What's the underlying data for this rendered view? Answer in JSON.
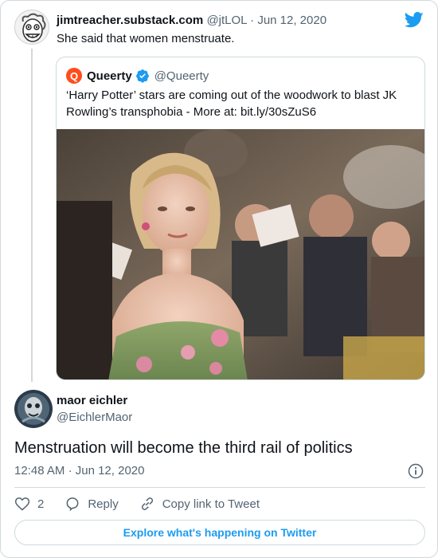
{
  "parent": {
    "display_name": "jimtreacher.substack.com",
    "handle": "@jtLOL",
    "separator": "·",
    "date": "Jun 12, 2020",
    "text": "She said that women menstruate."
  },
  "quoted": {
    "logo_letter": "Q",
    "display_name": "Queerty",
    "handle": "@Queerty",
    "text": "‘Harry Potter’ stars are coming out of the woodwork to blast JK Rowling’s transphobia - More at: bit.ly/30sZuS6"
  },
  "reply": {
    "display_name": "maor eichler",
    "handle": "@EichlerMaor",
    "text": "Menstruation will become the third rail of politics",
    "time": "12:48 AM",
    "separator": "·",
    "date": "Jun 12, 2020"
  },
  "actions": {
    "like_count": "2",
    "reply_label": "Reply",
    "copy_link_label": "Copy link to Tweet"
  },
  "footer": {
    "explore_label": "Explore what's happening on Twitter"
  },
  "colors": {
    "accent": "#1d9bf0",
    "queerty_brand": "#ff4d1c",
    "secondary_text": "#536471",
    "border": "#cfd9de"
  },
  "icons": {
    "brand": "twitter-bird-icon",
    "verified": "verified-badge-icon",
    "info": "info-icon",
    "like": "heart-icon",
    "reply": "reply-bubble-icon",
    "copy_link": "link-icon"
  }
}
